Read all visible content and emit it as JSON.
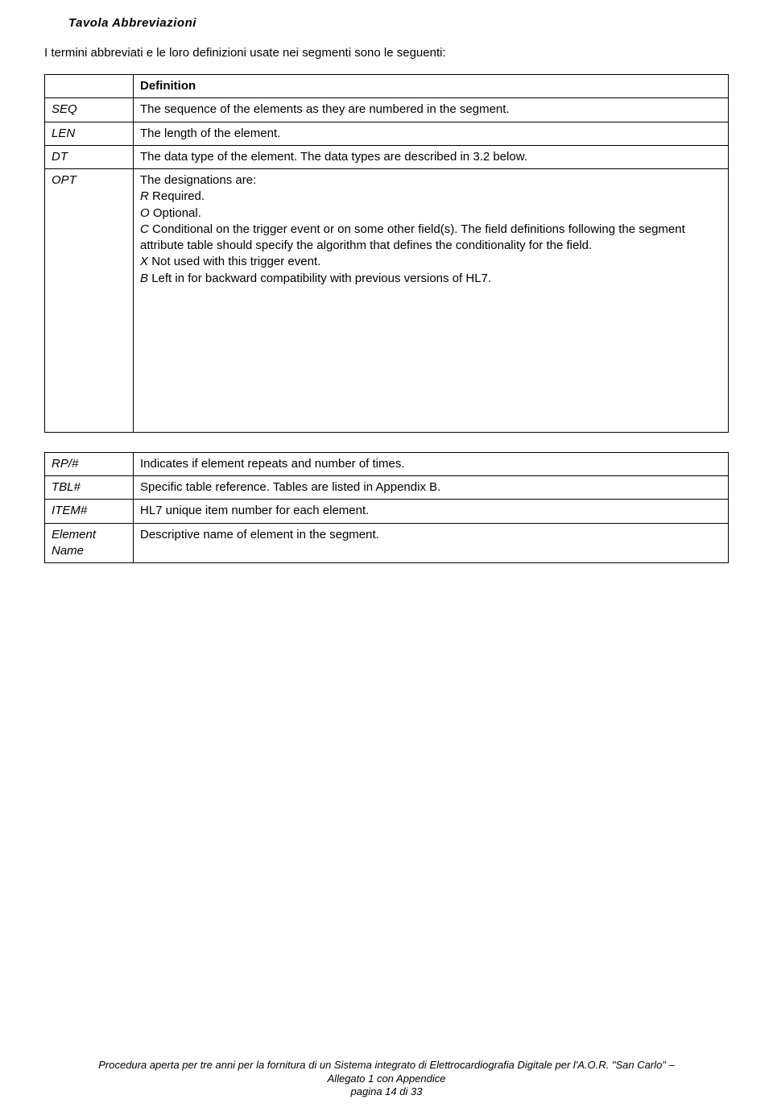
{
  "section_title": "Tavola Abbreviazioni",
  "intro": "I termini abbreviati e le loro definizioni usate nei segmenti sono le seguenti:",
  "table": {
    "header": {
      "col2": "Definition"
    },
    "rows": [
      {
        "term": "SEQ",
        "def": "The sequence of the elements as they are numbered in the segment."
      },
      {
        "term": "LEN",
        "def": "The length of the element."
      },
      {
        "term": "DT",
        "def": "The data type of the element.  The data types are described in 3.2 below."
      }
    ],
    "opt": {
      "term": "OPT",
      "lead": "The designations are:",
      "items": [
        {
          "code": "R",
          "text": "Required."
        },
        {
          "code": "O",
          "text": "Optional."
        },
        {
          "code": "C",
          "text": "Conditional on the trigger event or on some other field(s). The field definitions following the segment attribute table should specify the algorithm that defines the conditionality for the field."
        },
        {
          "code": "X",
          "text": "Not used with this trigger event."
        },
        {
          "code": "B",
          "text": "Left in for backward compatibility with previous versions of HL7."
        }
      ]
    },
    "rows2": [
      {
        "term": "RP/#",
        "def": "Indicates if element repeats and number of times."
      },
      {
        "term": "TBL#",
        "def": "Specific table reference. Tables are listed in Appendix B."
      },
      {
        "term": "ITEM#",
        "def": "HL7 unique item number for each element."
      },
      {
        "term": "Element Name",
        "def": "Descriptive name of element in the segment."
      }
    ]
  },
  "footer": {
    "line1": "Procedura aperta per tre anni per la fornitura di un Sistema integrato di Elettrocardiografia Digitale per l'A.O.R. \"San Carlo\" –",
    "line2": "Allegato 1 con Appendice",
    "line3": "pagina 14 di 33"
  }
}
